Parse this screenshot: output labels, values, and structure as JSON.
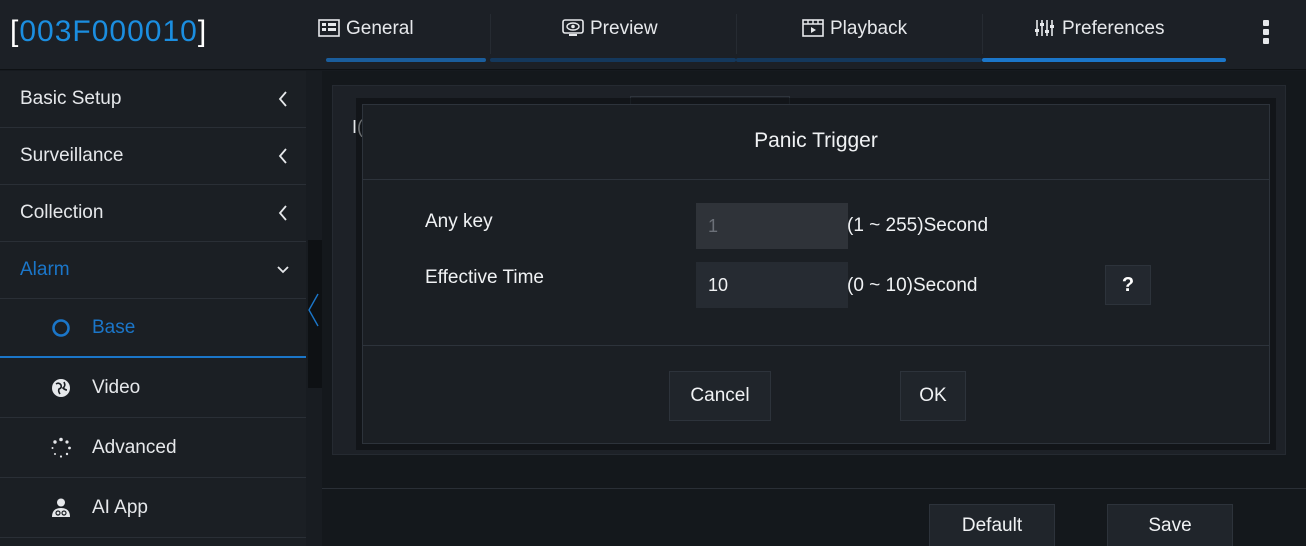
{
  "header": {
    "device_id": "003F000010",
    "bracket_open": "[",
    "bracket_close": "]",
    "tabs": [
      {
        "label": "General",
        "icon": "grid-icon"
      },
      {
        "label": "Preview",
        "icon": "eye-icon"
      },
      {
        "label": "Playback",
        "icon": "film-icon"
      },
      {
        "label": "Preferences",
        "icon": "sliders-icon"
      }
    ],
    "active_tab": "Preferences",
    "accent_color": "#1b76c9",
    "id_color": "#1b8ee0"
  },
  "sidebar": {
    "items": [
      {
        "label": "Basic Setup",
        "expanded": false
      },
      {
        "label": "Surveillance",
        "expanded": false
      },
      {
        "label": "Collection",
        "expanded": false
      },
      {
        "label": "Alarm",
        "expanded": true
      }
    ],
    "sub_items": [
      {
        "label": "Base",
        "icon": "circle-icon",
        "selected": true
      },
      {
        "label": "Video",
        "icon": "globe-icon",
        "selected": false
      },
      {
        "label": "Advanced",
        "icon": "dots-circle-icon",
        "selected": false
      },
      {
        "label": "AI App",
        "icon": "ai-user-icon",
        "selected": false
      }
    ]
  },
  "main": {
    "ghost_label": "I(",
    "default_label": "Default",
    "save_label": "Save"
  },
  "dialog": {
    "title": "Panic Trigger",
    "fields": [
      {
        "label": "Any key",
        "value": "1",
        "unit": "(1 ~ 255)Second",
        "disabled": true
      },
      {
        "label": "Effective Time",
        "value": "10",
        "unit": "(0 ~ 10)Second",
        "disabled": false
      }
    ],
    "help_label": "?",
    "cancel_label": "Cancel",
    "ok_label": "OK"
  }
}
